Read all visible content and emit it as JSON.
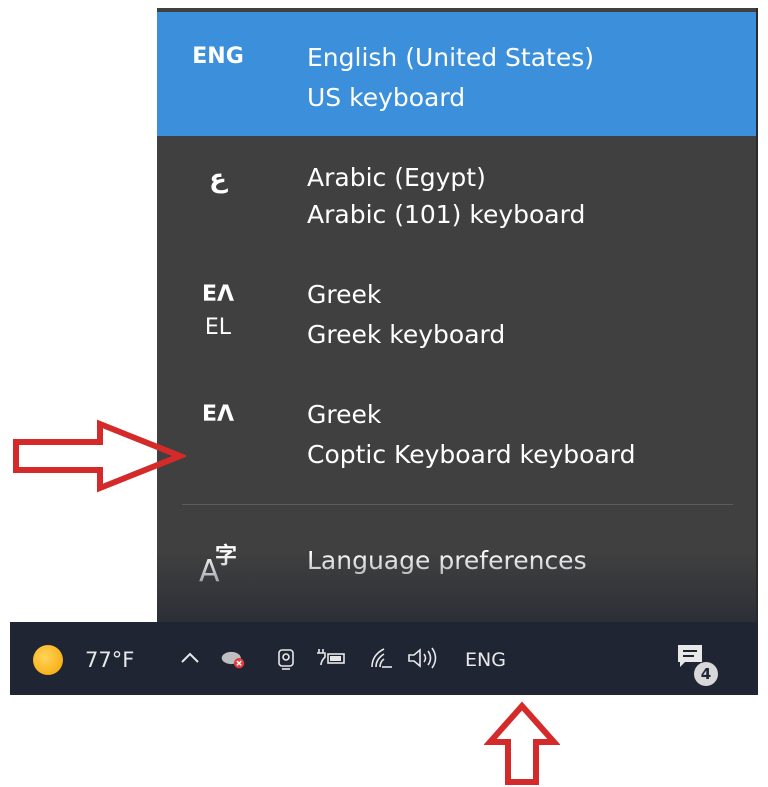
{
  "language_flyout": {
    "items": [
      {
        "tag": "ENG",
        "sub_tag": "",
        "name": "English (United States)",
        "keyboard": "US keyboard",
        "selected": true
      },
      {
        "tag": "ع",
        "sub_tag": "",
        "name": "Arabic (Egypt)",
        "keyboard": "Arabic (101) keyboard",
        "selected": false
      },
      {
        "tag": "ΕΛ",
        "sub_tag": "EL",
        "name": "Greek",
        "keyboard": "Greek keyboard",
        "selected": false
      },
      {
        "tag": "ΕΛ",
        "sub_tag": "",
        "name": "Greek",
        "keyboard": "Coptic Keyboard keyboard",
        "selected": false
      }
    ],
    "preferences_label": "Language preferences",
    "preferences_icon_glyph_a": "A",
    "preferences_icon_glyph_char": "字"
  },
  "taskbar": {
    "weather_temp": "77°F",
    "language_indicator": "ENG",
    "notification_count": "4",
    "icons": [
      "show-hidden-icons-chevron",
      "onedrive-error-icon",
      "meet-now-icon",
      "battery-charging-icon",
      "wifi-icon",
      "volume-icon",
      "action-center-icon"
    ]
  },
  "annotations": {
    "arrow_color": "#d42a2a",
    "arrows": [
      "right-pointing-arrow",
      "up-pointing-arrow"
    ]
  },
  "colors": {
    "flyout_bg": "#404040",
    "selected_bg": "#3b8fdb",
    "taskbar_bg": "#1f2533"
  }
}
